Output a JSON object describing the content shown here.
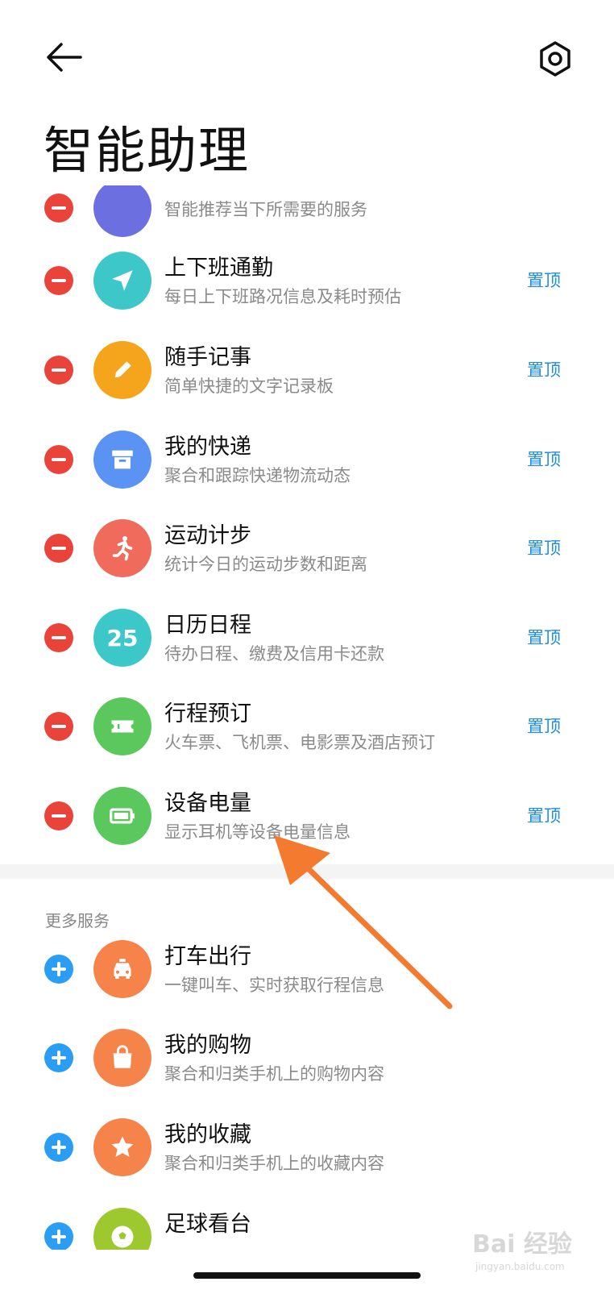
{
  "header": {
    "title": "智能助理",
    "back_icon": "arrow-left-icon",
    "settings_icon": "hexagon-settings-icon"
  },
  "partial_row": {
    "desc": "智能推荐当下所需要的服务",
    "icon_color": "#6b6fe0"
  },
  "added_items": [
    {
      "title": "上下班通勤",
      "desc": "每日上下班路况信息及耗时预估",
      "pin": "置顶",
      "icon": "navigation-arrow-icon",
      "color": "#3ec7c9"
    },
    {
      "title": "随手记事",
      "desc": "简单快捷的文字记录板",
      "pin": "置顶",
      "icon": "pencil-icon",
      "color": "#f4a51c"
    },
    {
      "title": "我的快递",
      "desc": "聚合和跟踪快递物流动态",
      "pin": "置顶",
      "icon": "archive-box-icon",
      "color": "#5b93f5"
    },
    {
      "title": "运动计步",
      "desc": "统计今日的运动步数和距离",
      "pin": "置顶",
      "icon": "running-person-icon",
      "color": "#f06b5b"
    },
    {
      "title": "日历日程",
      "desc": "待办日程、缴费及信用卡还款",
      "pin": "置顶",
      "icon": "calendar-date-icon",
      "icon_text": "25",
      "color": "#3cc7c8"
    },
    {
      "title": "行程预订",
      "desc": "火车票、飞机票、电影票及酒店预订",
      "pin": "置顶",
      "icon": "ticket-icon",
      "color": "#5bc85d"
    },
    {
      "title": "设备电量",
      "desc": "显示耳机等设备电量信息",
      "pin": "置顶",
      "icon": "battery-icon",
      "color": "#5bc85d"
    }
  ],
  "more_section": {
    "label": "更多服务",
    "items": [
      {
        "title": "打车出行",
        "desc": "一键叫车、实时获取行程信息",
        "icon": "taxi-icon",
        "color": "#f5834a"
      },
      {
        "title": "我的购物",
        "desc": "聚合和归类手机上的购物内容",
        "icon": "shopping-bag-icon",
        "color": "#f5834a"
      },
      {
        "title": "我的收藏",
        "desc": "聚合和归类手机上的收藏内容",
        "icon": "star-icon",
        "color": "#f5834a"
      },
      {
        "title": "足球看台",
        "desc": "",
        "icon": "soccer-ball-icon",
        "color": "#9dc92e"
      }
    ]
  },
  "watermark": {
    "text": "Bai 经验",
    "sub": "jingyan.baidu.com"
  },
  "annotation": {
    "arrow_color": "#f47a30"
  }
}
